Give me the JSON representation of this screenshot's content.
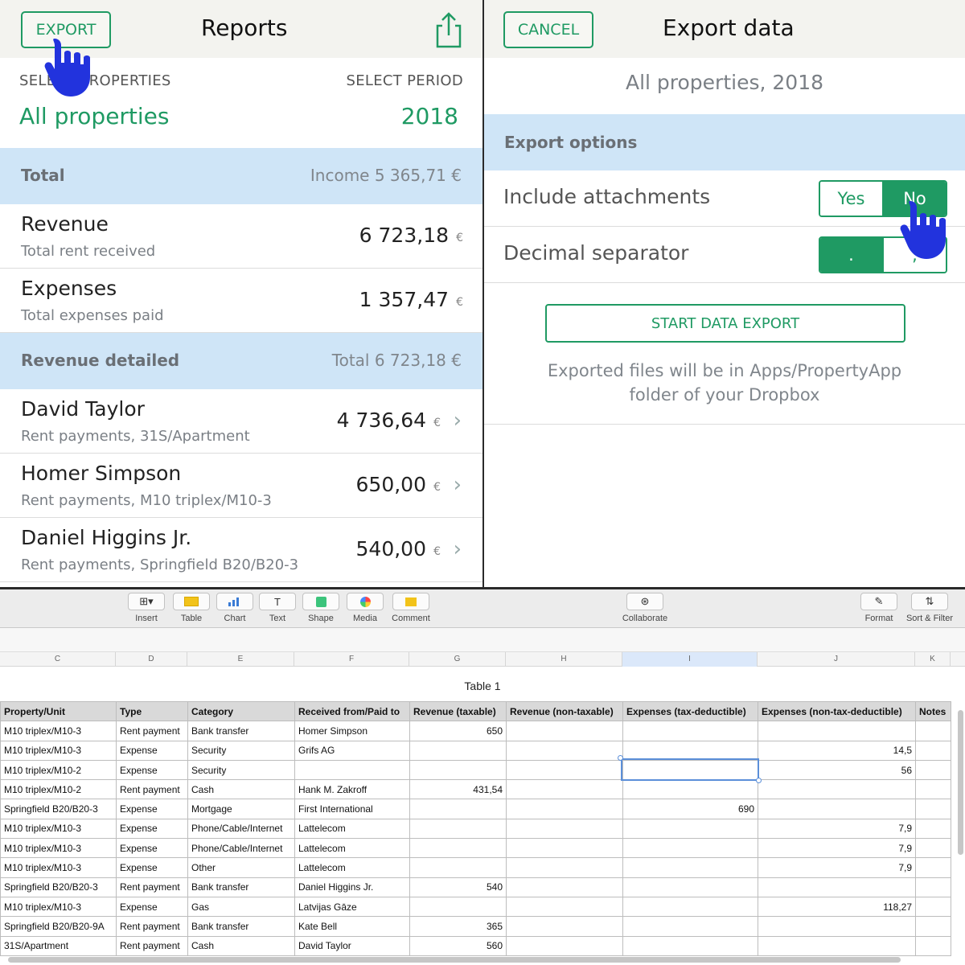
{
  "left": {
    "nav": {
      "export_label": "EXPORT",
      "title": "Reports"
    },
    "select_properties_label": "SELECT PROPERTIES",
    "select_period_label": "SELECT PERIOD",
    "properties_value": "All properties",
    "period_value": "2018",
    "total": {
      "label": "Total",
      "value": "Income 5 365,71 €"
    },
    "revenue": {
      "title": "Revenue",
      "sub": "Total rent received",
      "amount": "6 723,18",
      "currency": "€"
    },
    "expenses": {
      "title": "Expenses",
      "sub": "Total expenses paid",
      "amount": "1 357,47",
      "currency": "€"
    },
    "revenue_detailed": {
      "label": "Revenue detailed",
      "value": "Total 6 723,18 €"
    },
    "tenants": [
      {
        "name": "David Taylor",
        "sub": "Rent payments, 31S/Apartment",
        "amount": "4 736,64",
        "currency": "€"
      },
      {
        "name": "Homer Simpson",
        "sub": "Rent payments, M10 triplex/M10-3",
        "amount": "650,00",
        "currency": "€"
      },
      {
        "name": "Daniel Higgins Jr.",
        "sub": "Rent payments, Springfield B20/B20-3",
        "amount": "540,00",
        "currency": "€"
      }
    ]
  },
  "right": {
    "nav": {
      "cancel_label": "CANCEL",
      "title": "Export data"
    },
    "subtitle": "All properties, 2018",
    "export_options_label": "Export options",
    "include_attachments": {
      "label": "Include attachments",
      "yes": "Yes",
      "no": "No",
      "selected": "No"
    },
    "decimal_separator": {
      "label": "Decimal separator",
      "dot": ".",
      "comma": ",",
      "selected": "."
    },
    "start_label": "START DATA EXPORT",
    "note_line1": "Exported files will be in Apps/PropertyApp",
    "note_line2": "folder of your Dropbox"
  },
  "sheet": {
    "toolbar": {
      "insert": "Insert",
      "table": "Table",
      "chart": "Chart",
      "text": "Text",
      "shape": "Shape",
      "media": "Media",
      "comment": "Comment",
      "collaborate": "Collaborate",
      "format": "Format",
      "sort_filter": "Sort & Filter"
    },
    "column_letters": [
      "C",
      "D",
      "E",
      "F",
      "G",
      "H",
      "I",
      "J",
      "K"
    ],
    "selected_column": "I",
    "table_title": "Table 1",
    "headers": [
      "Property/Unit",
      "Type",
      "Category",
      "Received from/Paid to",
      "Revenue (taxable)",
      "Revenue (non-taxable)",
      "Expenses (tax-deductible)",
      "Expenses (non-tax-deductible)",
      "Notes"
    ],
    "rows": [
      [
        "M10 triplex/M10-3",
        "Rent payment",
        "Bank transfer",
        "Homer Simpson",
        "650",
        "",
        "",
        "",
        ""
      ],
      [
        "M10 triplex/M10-3",
        "Expense",
        "Security",
        "Grifs AG",
        "",
        "",
        "",
        "14,5",
        ""
      ],
      [
        "M10 triplex/M10-2",
        "Expense",
        "Security",
        "",
        "",
        "",
        "",
        "56",
        ""
      ],
      [
        "M10 triplex/M10-2",
        "Rent payment",
        "Cash",
        "Hank M. Zakroff",
        "431,54",
        "",
        "",
        "",
        ""
      ],
      [
        "Springfield B20/B20-3",
        "Expense",
        "Mortgage",
        "First International",
        "",
        "",
        "690",
        "",
        ""
      ],
      [
        "M10 triplex/M10-3",
        "Expense",
        "Phone/Cable/Internet",
        "Lattelecom",
        "",
        "",
        "",
        "7,9",
        ""
      ],
      [
        "M10 triplex/M10-3",
        "Expense",
        "Phone/Cable/Internet",
        "Lattelecom",
        "",
        "",
        "",
        "7,9",
        ""
      ],
      [
        "M10 triplex/M10-3",
        "Expense",
        "Other",
        "Lattelecom",
        "",
        "",
        "",
        "7,9",
        ""
      ],
      [
        "Springfield B20/B20-3",
        "Rent payment",
        "Bank transfer",
        "Daniel Higgins Jr.",
        "540",
        "",
        "",
        "",
        ""
      ],
      [
        "M10 triplex/M10-3",
        "Expense",
        "Gas",
        "Latvijas Gāze",
        "",
        "",
        "",
        "118,27",
        ""
      ],
      [
        "Springfield B20/B20-9A",
        "Rent payment",
        "Bank transfer",
        "Kate Bell",
        "365",
        "",
        "",
        "",
        ""
      ],
      [
        "31S/Apartment",
        "Rent payment",
        "Cash",
        "David Taylor",
        "560",
        "",
        "",
        "",
        ""
      ]
    ]
  },
  "colors": {
    "accent": "#1f9a63",
    "section_bg": "#cfe5f7",
    "cursor": "#2233dd"
  }
}
